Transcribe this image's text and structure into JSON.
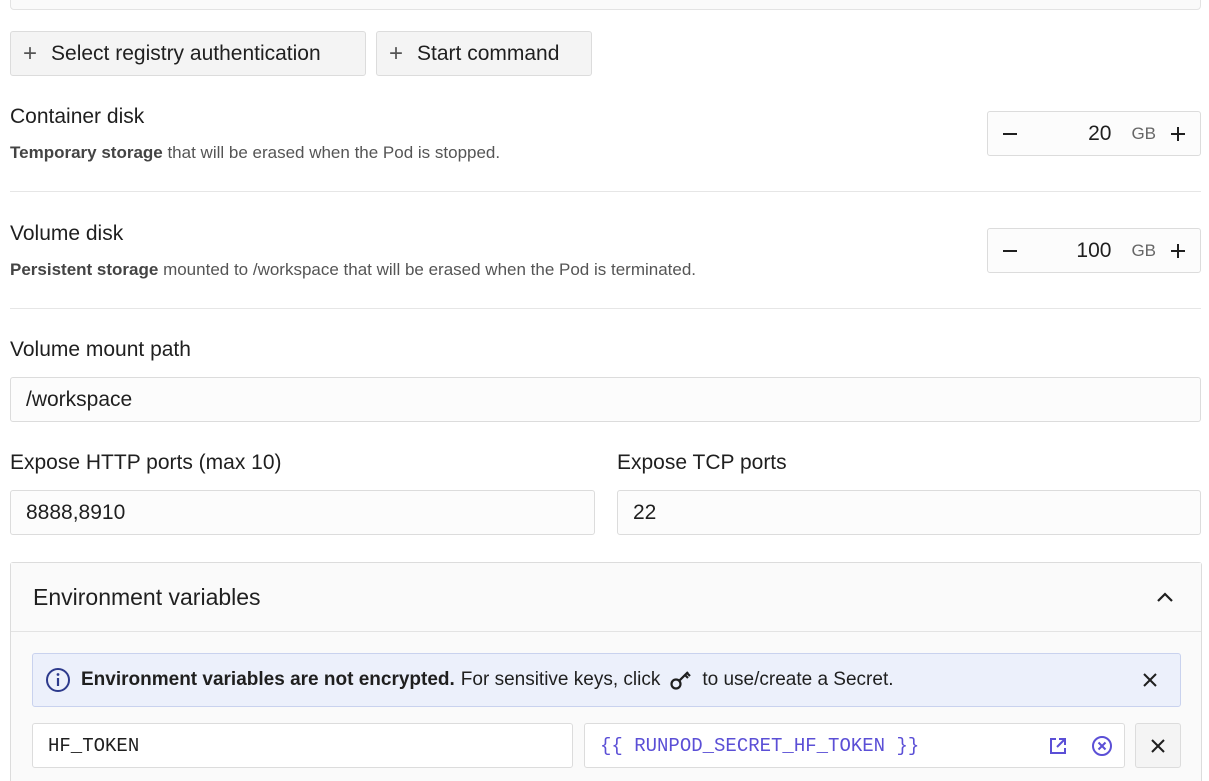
{
  "buttons": {
    "registry_auth": "Select registry authentication",
    "start_command": "Start command",
    "plus_glyph": "+"
  },
  "container_disk": {
    "title": "Container disk",
    "desc_bold": "Temporary storage",
    "desc_rest": " that will be erased when the Pod is stopped.",
    "value": "20",
    "unit": "GB"
  },
  "volume_disk": {
    "title": "Volume disk",
    "desc_bold": "Persistent storage",
    "desc_rest": " mounted to /workspace that will be erased when the Pod is terminated.",
    "value": "100",
    "unit": "GB"
  },
  "volume_mount": {
    "label": "Volume mount path",
    "value": "/workspace"
  },
  "http_ports": {
    "label": "Expose HTTP ports (max 10)",
    "value": "8888,8910"
  },
  "tcp_ports": {
    "label": "Expose TCP ports",
    "value": "22"
  },
  "env": {
    "title": "Environment variables",
    "banner_bold": "Environment variables are not encrypted.",
    "banner_text1": "For sensitive keys, click",
    "banner_text2": "to use/create a Secret.",
    "rows": [
      {
        "key": "HF_TOKEN",
        "value": "{{ RUNPOD_SECRET_HF_TOKEN }}"
      }
    ]
  },
  "colors": {
    "accent": "#5b4fd6",
    "info_bg": "#ecf0fb",
    "info_icon": "#2d3a8c"
  },
  "icons": {
    "stepper_minus": "minus-icon",
    "stepper_plus": "plus-icon",
    "collapse": "chevron-up-icon",
    "info": "info-circle-icon",
    "secret": "key-icon",
    "close": "close-icon",
    "open_external": "external-link-icon",
    "clear": "clear-circle-icon"
  }
}
